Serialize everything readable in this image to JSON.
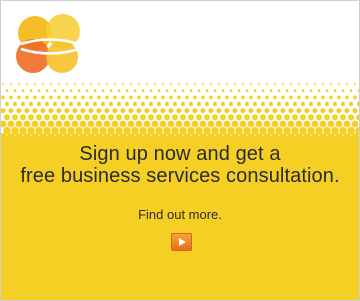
{
  "ad": {
    "headline_line1": "Sign up now and get a",
    "headline_line2": "free business services consultation.",
    "cta_text": "Find out more.",
    "logo_icon": "overlapping-circles-logo",
    "cta_icon": "play-arrow-icon",
    "colors": {
      "background": "#ffffff",
      "band": "#f6cf24",
      "text": "#2b2b2b",
      "button": "#ee8a2c",
      "logo_orange": "#ef6a24",
      "logo_yellow": "#f7c52a"
    }
  }
}
